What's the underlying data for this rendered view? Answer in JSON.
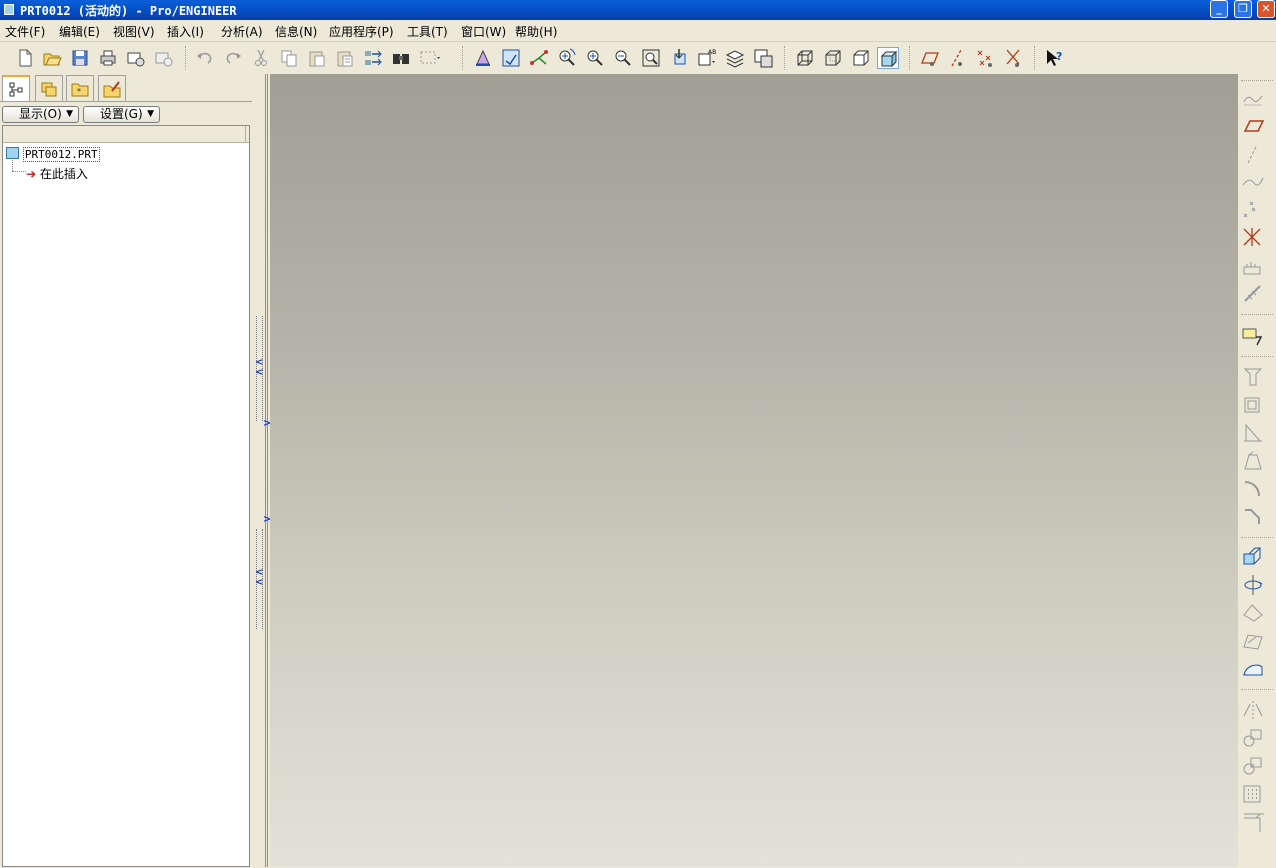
{
  "window": {
    "title": "PRT0012 (活动的) - Pro/ENGINEER",
    "minimize": "_",
    "restore": "❐",
    "close": "✕"
  },
  "menu": [
    {
      "label": "文件(F)"
    },
    {
      "label": "编辑(E)"
    },
    {
      "label": "视图(V)"
    },
    {
      "label": "插入(I)"
    },
    {
      "label": "分析(A)"
    },
    {
      "label": "信息(N)"
    },
    {
      "label": "应用程序(P)"
    },
    {
      "label": "工具(T)"
    },
    {
      "label": "窗口(W)"
    },
    {
      "label": "帮助(H)"
    }
  ],
  "toolbar_icons": [
    "new-icon",
    "open-icon",
    "save-icon",
    "print-icon",
    "send-mail-icon",
    "send-link-icon",
    "undo-icon",
    "redo-icon",
    "cut-icon",
    "copy-icon",
    "paste-icon",
    "paste-special-icon",
    "regenerate-icon",
    "find-icon",
    "selection-box-icon",
    "repaint-icon",
    "orient-icon",
    "spin-center-icon",
    "zoom-in-icon",
    "zoom-out-icon",
    "refit-icon",
    "reorient-icon",
    "annotation-display-icon",
    "layers-icon",
    "view-manager-icon",
    "wireframe-icon",
    "hidden-line-icon",
    "no-hidden-icon",
    "shading-icon",
    "datum-planes-display-icon",
    "datum-axes-display-icon",
    "datum-points-display-icon",
    "csys-display-icon",
    "context-help-icon"
  ],
  "panel": {
    "tabs": [
      "model-tree-tab-icon",
      "folder-browser-tab-icon",
      "favorites-tab-icon",
      "connections-tab-icon"
    ],
    "show_button": "显示(O)",
    "settings_button": "设置(G)",
    "tree": {
      "root": "PRT0012.PRT",
      "insert_here": "在此插入"
    }
  },
  "right_toolbar_icons": [
    "sketched-datum-icon",
    "datum-plane-icon",
    "datum-axis-icon",
    "datum-curve-icon",
    "datum-point-icon",
    "datum-csys-icon",
    "analysis-feature-icon",
    "datum-graph-icon",
    "sketch-tool-icon",
    "hole-icon",
    "shell-icon",
    "rib-icon",
    "draft-icon",
    "round-icon",
    "chamfer-icon",
    "extrude-icon",
    "revolve-icon",
    "variable-sweep-icon",
    "blend-icon",
    "style-icon",
    "mirror-icon",
    "merge-icon",
    "trim-icon",
    "pattern-icon",
    "offset-icon"
  ],
  "colors": {
    "title_bar": "#0553c9",
    "graphics_top": "#a19f94",
    "graphics_bottom": "#e4e2d8",
    "chrome": "#ece9d8"
  }
}
